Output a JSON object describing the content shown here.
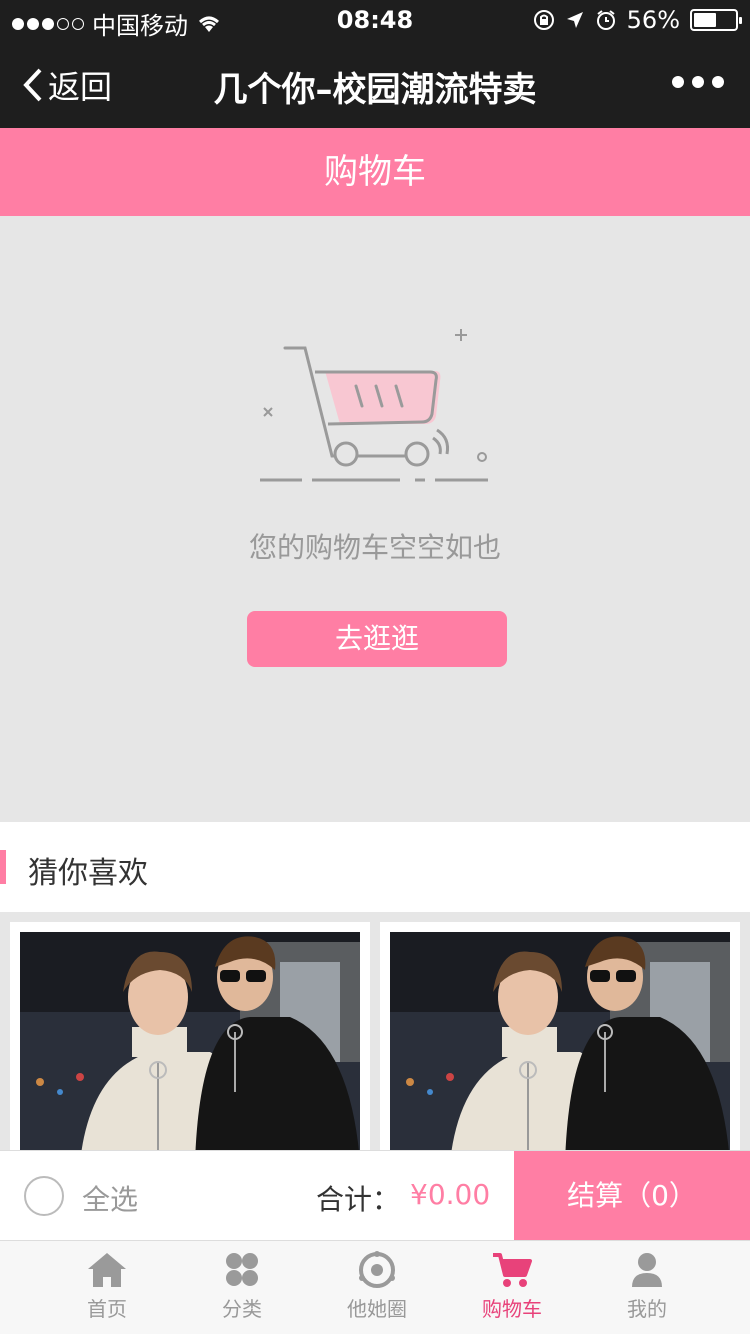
{
  "status_bar": {
    "carrier": "中国移动",
    "time": "08:48",
    "battery": "56%",
    "battery_level": 0.56
  },
  "navbar": {
    "back_label": "返回",
    "title": "几个你–校园潮流特卖"
  },
  "cart_header": {
    "title": "购物车"
  },
  "empty_state": {
    "message": "您的购物车空空如也",
    "button_label": "去逛逛"
  },
  "recommend": {
    "title": "猜你喜欢"
  },
  "checkout": {
    "select_all_label": "全选",
    "total_label": "合计：",
    "total_value": "¥0.00",
    "button_label": "结算（0）"
  },
  "tabbar": {
    "items": [
      {
        "label": "首页",
        "icon": "home-icon"
      },
      {
        "label": "分类",
        "icon": "category-icon"
      },
      {
        "label": "他她圈",
        "icon": "circle-icon"
      },
      {
        "label": "购物车",
        "icon": "cart-icon",
        "active": true
      },
      {
        "label": "我的",
        "icon": "profile-icon"
      }
    ]
  },
  "colors": {
    "accent": "#ff7ea4",
    "active_tab": "#e8427a",
    "navbar_bg": "#1e1e1e"
  }
}
